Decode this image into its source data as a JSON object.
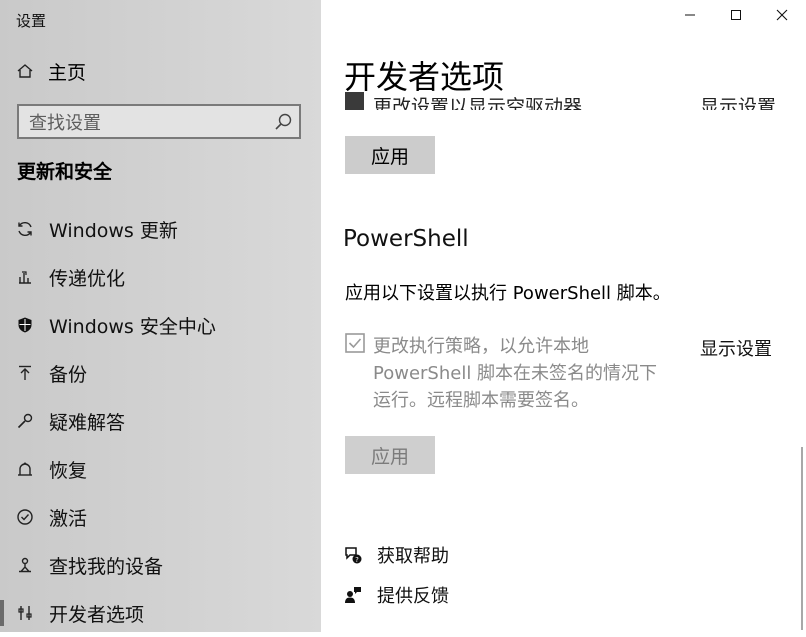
{
  "window": {
    "app_title": "设置",
    "controls": {
      "minimize": "—",
      "maximize": "□",
      "close": "✕"
    }
  },
  "sidebar": {
    "home_label": "主页",
    "search_placeholder": "查找设置",
    "section_title": "更新和安全",
    "items": [
      {
        "label": "Windows 更新",
        "icon": "sync-icon",
        "selected": false
      },
      {
        "label": "传递优化",
        "icon": "delivery-optimization-icon",
        "selected": false
      },
      {
        "label": "Windows 安全中心",
        "icon": "shield-icon",
        "selected": false
      },
      {
        "label": "备份",
        "icon": "backup-arrow-icon",
        "selected": false
      },
      {
        "label": "疑难解答",
        "icon": "wrench-icon",
        "selected": false
      },
      {
        "label": "恢复",
        "icon": "recovery-icon",
        "selected": false
      },
      {
        "label": "激活",
        "icon": "activation-check-icon",
        "selected": false
      },
      {
        "label": "查找我的设备",
        "icon": "find-device-icon",
        "selected": false
      },
      {
        "label": "开发者选项",
        "icon": "developer-tools-icon",
        "selected": true
      }
    ]
  },
  "main": {
    "page_title": "开发者选项",
    "cut_row": {
      "label": "更改设置以显示空驱动器",
      "show_settings": "显示设置"
    },
    "apply_label_1": "应用",
    "powershell": {
      "heading": "PowerShell",
      "description": "应用以下设置以执行 PowerShell 脚本。",
      "checkbox_checked": true,
      "checkbox_label_lines": [
        "更改执行策略，以允许本地",
        "PowerShell 脚本在未签名的情况下",
        "运行。远程脚本需要签名。"
      ],
      "show_settings": "显示设置",
      "apply_label": "应用"
    },
    "footer": {
      "help_label": "获取帮助",
      "feedback_label": "提供反馈"
    }
  },
  "colors": {
    "sidebar_bg": "#d2d2d2",
    "button_bg": "#cccccc",
    "disabled_text": "#8a8a8a"
  }
}
